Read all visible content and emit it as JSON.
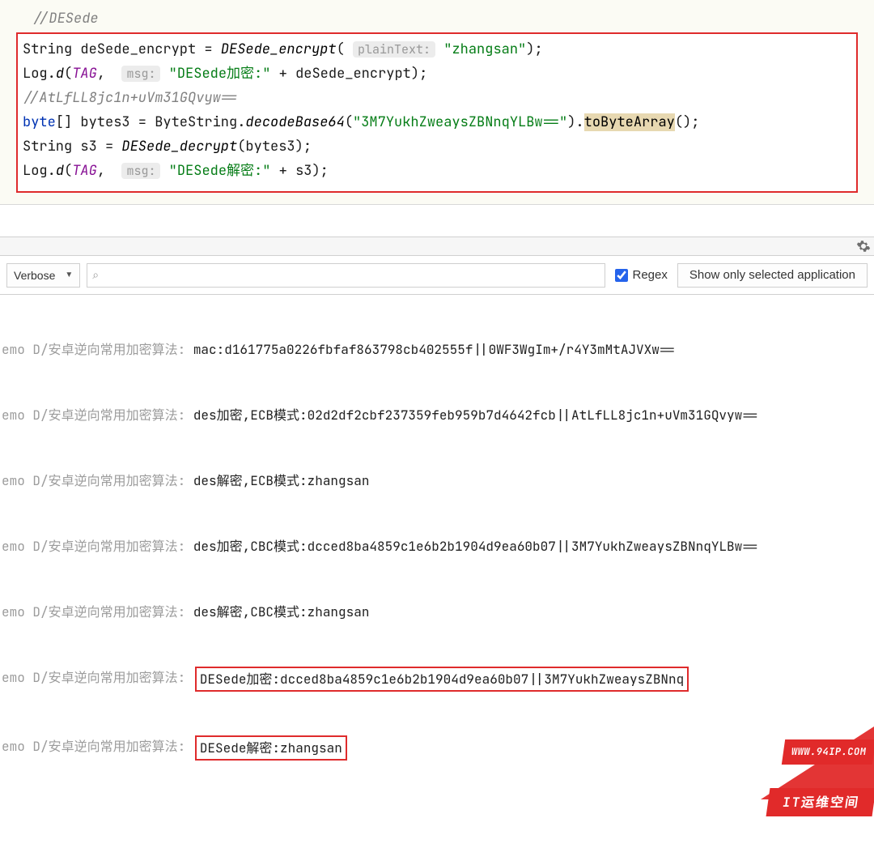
{
  "code": {
    "comment_top": "//DESede",
    "l1_a": "String deSede_encrypt = ",
    "l1_b": "DESede_encrypt",
    "l1_hint": "plainText:",
    "l1_str": "\"zhangsan\"",
    "l1_c": ");",
    "l2_a": "Log.",
    "l2_b": "d",
    "l2_c": "(",
    "l2_tag": "TAG",
    "l2_hint": "msg:",
    "l2_str": "\"DESede加密:\"",
    "l2_d": " + deSede_encrypt);",
    "l3_cmt": "//AtLfLL8jc1n+uVm31GQvyw==",
    "l4_a": "byte",
    "l4_b": "[] bytes3 = ByteString.",
    "l4_c": "decodeBase64",
    "l4_str": "\"3M7YukhZweaysZBNnqYLBw==\"",
    "l4_d": ").",
    "l4_e": "toByteArray",
    "l4_f": "();",
    "l5_a": "String s3 = ",
    "l5_b": "DESede_decrypt",
    "l5_c": "(bytes3);",
    "l6_a": "Log.",
    "l6_b": "d",
    "l6_c": "(",
    "l6_tag": "TAG",
    "l6_hint": "msg:",
    "l6_str": "\"DESede解密:\"",
    "l6_d": " + s3);"
  },
  "filter": {
    "level": "Verbose",
    "search_icon": "⌕",
    "search_value": "",
    "regex_label": "Regex",
    "app_label": "Show only selected application"
  },
  "log": {
    "src": "emo D/安卓逆向常用加密算法: ",
    "lines": [
      "mac:d161775a0226fbfaf863798cb402555f||0WF3WgIm+/r4Y3mMtAJVXw==",
      "des加密,ECB模式:02d2df2cbf237359feb959b7d4642fcb||AtLfLL8jc1n+uVm31GQvyw==",
      "des解密,ECB模式:zhangsan",
      "des加密,CBC模式:dcced8ba4859c1e6b2b1904d9ea60b07||3M7YukhZweaysZBNnqYLBw==",
      "des解密,CBC模式:zhangsan"
    ],
    "boxed1": "DESede加密:dcced8ba4859c1e6b2b1904d9ea60b07||3M7YukhZweaysZBNnq",
    "boxed2": "DESede解密:zhangsan"
  },
  "watermark": {
    "top": "WWW.94IP.COM",
    "bot": "IT运维空间"
  }
}
